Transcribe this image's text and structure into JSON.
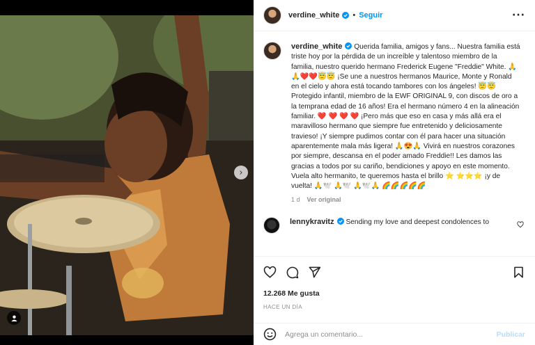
{
  "post": {
    "username": "verdine_white",
    "follow_label": "Seguir",
    "separator": "•",
    "more_icon": "more-horizontal-icon"
  },
  "caption": {
    "username": "verdine_white",
    "text": "Querida familia, amigos y fans... Nuestra familia está triste hoy por la pérdida de un increíble y talentoso miembro de la familia, nuestro querido hermano Frederick Eugene \"Freddie\" White. 🙏🙏❤️❤️😇😇 ¡Se une a nuestros hermanos Maurice, Monte y Ronald en el cielo y ahora está tocando tambores con los ángeles! 😇😇 Protegido infantil, miembro de la EWF ORIGINAL 9, con discos de oro a la temprana edad de 16 años! Era el hermano número 4 en la alineación familiar. ❤️ ❤️ ❤️ ❤️ ¡Pero más que eso en casa y más allá era el maravilloso hermano que siempre fue entretenido y deliciosamente travieso! ¡Y siempre pudimos contar con él para hacer una situación aparentemente mala más ligera! 🙏😍🙏 Vivirá en nuestros corazones por siempre, descansa en el poder amado Freddie!! Les damos las gracias a todos por su cariño, bendiciones y apoyo en este momento. Vuela alto hermanito, te queremos hasta el brillo ⭐ ⭐⭐⭐ ¡y de vuelta! 🙏🕊️ 🙏🕊️ 🙏🕊️🙏 🌈🌈🌈🌈🌈",
    "age": "1 d",
    "translate_label": "Ver original"
  },
  "comment": {
    "username": "lennykravitz",
    "text": "Sending my love and deepest condolences to"
  },
  "actions": {
    "likes": "12.268 Me gusta",
    "time": "HACE UN DÍA"
  },
  "compose": {
    "placeholder": "Agrega un comentario...",
    "post_label": "Publicar"
  },
  "colors": {
    "accent": "#0095f6",
    "post_disabled": "#b2dffc",
    "muted": "#8e8e8e"
  }
}
